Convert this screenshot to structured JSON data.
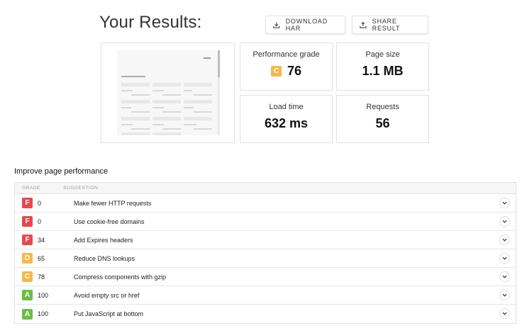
{
  "header": {
    "title": "Your Results:"
  },
  "buttons": {
    "download_har": "DOWNLOAD HAR",
    "share_result": "SHARE RESULT"
  },
  "metrics": {
    "performance": {
      "label": "Performance grade",
      "grade": "C",
      "value": "76"
    },
    "page_size": {
      "label": "Page size",
      "value": "1.1 MB"
    },
    "load_time": {
      "label": "Load time",
      "value": "632 ms"
    },
    "requests": {
      "label": "Requests",
      "value": "56"
    }
  },
  "improve": {
    "title": "Improve page performance",
    "columns": {
      "grade": "GRADE",
      "suggestion": "SUGGESTION"
    },
    "rows": [
      {
        "grade": "F",
        "score": "0",
        "suggestion": "Make fewer HTTP requests"
      },
      {
        "grade": "F",
        "score": "0",
        "suggestion": "Use cookie-free domains"
      },
      {
        "grade": "F",
        "score": "34",
        "suggestion": "Add Expires headers"
      },
      {
        "grade": "D",
        "score": "65",
        "suggestion": "Reduce DNS lookups"
      },
      {
        "grade": "C",
        "score": "78",
        "suggestion": "Compress components with gzip"
      },
      {
        "grade": "A",
        "score": "100",
        "suggestion": "Avoid empty src or href"
      },
      {
        "grade": "A",
        "score": "100",
        "suggestion": "Put JavaScript at bottom"
      }
    ]
  },
  "grade_colors": {
    "F": "#e8474c",
    "D": "#f3b94a",
    "C": "#f3b94a",
    "A": "#6cbd45"
  },
  "icons": {
    "download": "download-icon",
    "share": "share-icon",
    "expand": "chevron-down-icon"
  }
}
